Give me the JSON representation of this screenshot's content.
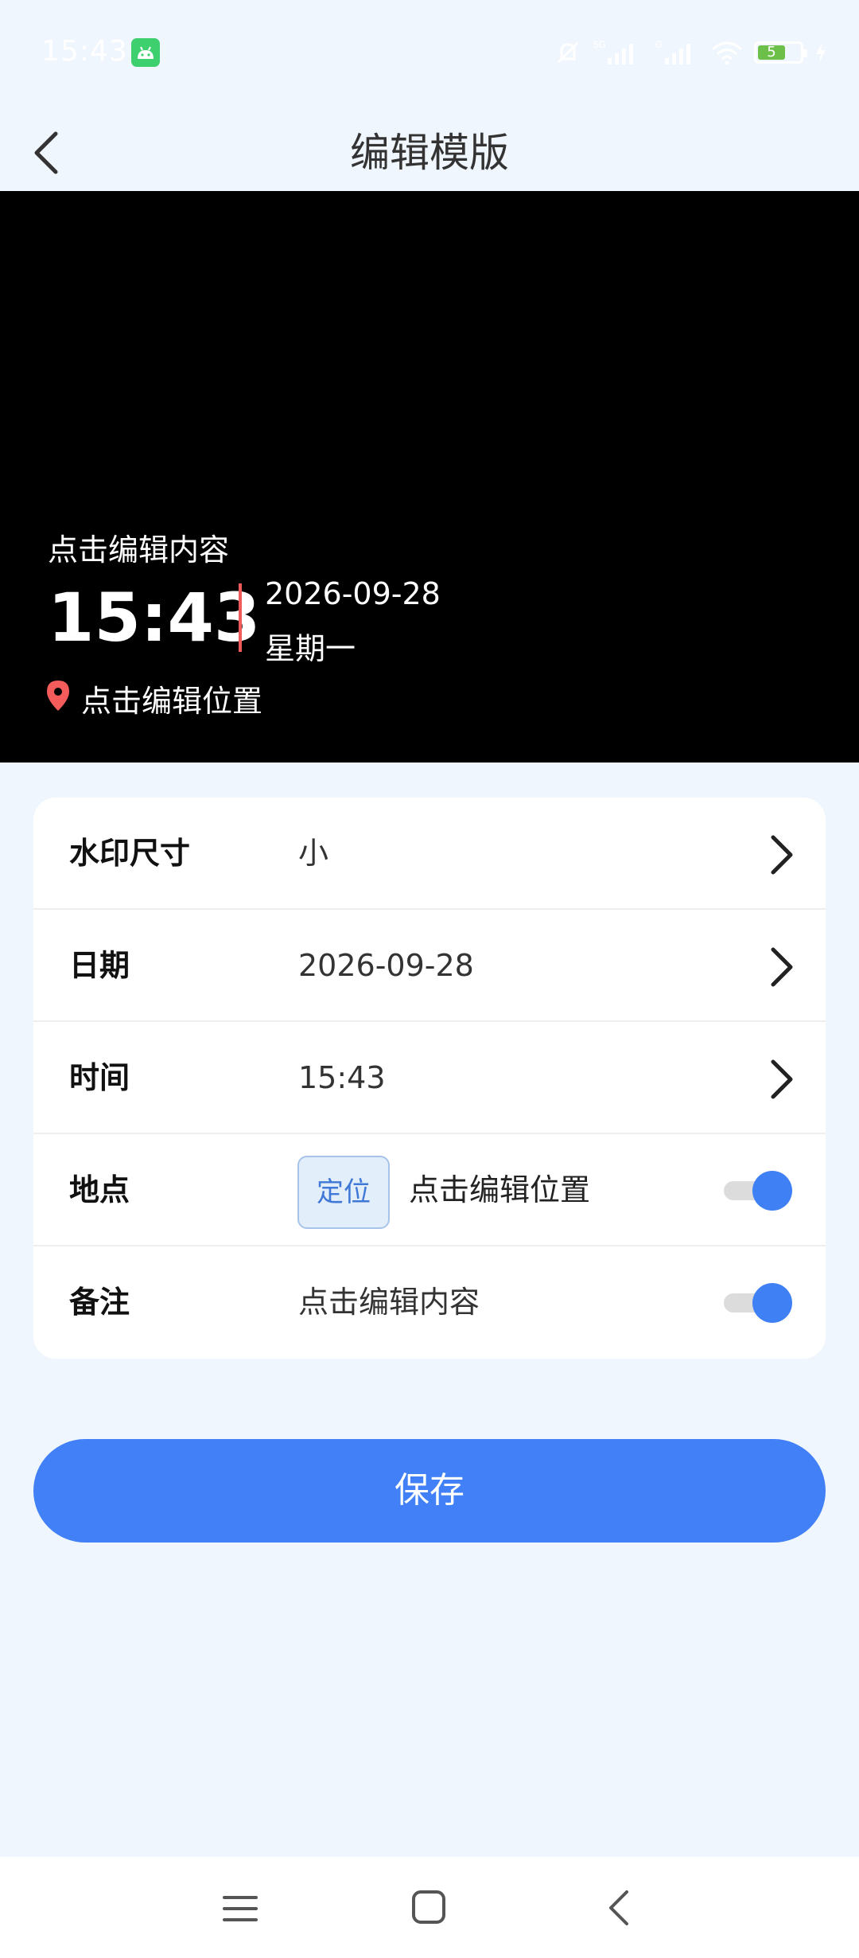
{
  "status_bar": {
    "time": "15:43",
    "battery_level": "5",
    "network_label": "5G",
    "network_label_2": "G"
  },
  "header": {
    "title": "编辑模版"
  },
  "preview": {
    "note": "点击编辑内容",
    "time": "15:43",
    "date": "2026-09-28",
    "weekday": "星期一",
    "location": "点击编辑位置"
  },
  "settings": {
    "rows": [
      {
        "label": "水印尺寸",
        "value": "小"
      },
      {
        "label": "日期",
        "value": "2026-09-28"
      },
      {
        "label": "时间",
        "value": "15:43"
      },
      {
        "label": "地点",
        "button": "定位",
        "value": "点击编辑位置",
        "toggle_on": true
      },
      {
        "label": "备注",
        "value": "点击编辑内容",
        "toggle_on": true
      }
    ]
  },
  "save_button": "保存",
  "colors": {
    "accent": "#4180f6",
    "background": "#f0f6fd",
    "divider_red": "#ef5a5a",
    "location_pin": "#f45b5b",
    "battery_green": "#6cc04a"
  },
  "icons": [
    "android-app-icon",
    "notification-muted-icon",
    "signal-icon",
    "wifi-icon",
    "battery-icon",
    "charging-icon",
    "back-arrow-icon",
    "location-pin-icon",
    "chevron-right-icon",
    "menu-icon",
    "home-icon",
    "nav-back-icon"
  ]
}
